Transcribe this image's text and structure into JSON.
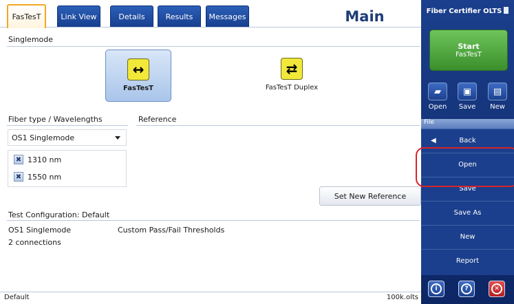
{
  "tabs": [
    {
      "label": "FasTesT",
      "active": true
    },
    {
      "label": "Link View",
      "active": false
    },
    {
      "label": "Details",
      "active": false
    },
    {
      "label": "Results",
      "active": false
    },
    {
      "label": "Messages",
      "active": false
    }
  ],
  "page_title": "Main",
  "mode_section": {
    "label": "Singlemode",
    "modes": [
      {
        "label": "FasTesT",
        "icon": "single-arrow-icon",
        "selected": true
      },
      {
        "label": "FasTesT Duplex",
        "icon": "duplex-arrows-icon",
        "selected": false
      }
    ]
  },
  "fiber": {
    "label": "Fiber type / Wavelengths",
    "selected": "OS1 Singlemode",
    "wavelengths": [
      "1310 nm",
      "1550 nm"
    ]
  },
  "reference": {
    "label": "Reference",
    "button_label": "Set New Reference"
  },
  "test_config": {
    "label": "Test Configuration: Default",
    "fiber_type": "OS1 Singlemode",
    "connections": "2 connections",
    "thresholds": "Custom Pass/Fail Thresholds"
  },
  "status": {
    "left": "Default",
    "right": "100k.olts"
  },
  "sidebar": {
    "title": "Fiber Certifier OLTS",
    "start": {
      "line1": "Start",
      "line2": "FasTesT"
    },
    "file_buttons": [
      {
        "label": "Open",
        "icon": "folder-icon"
      },
      {
        "label": "Save",
        "icon": "floppy-icon"
      },
      {
        "label": "New",
        "icon": "new-document-icon"
      }
    ],
    "menu_header": "File",
    "menu_items": [
      "Back",
      "Open",
      "Save",
      "Save As",
      "New",
      "Report"
    ],
    "bottom_icons": [
      "info-icon",
      "help-icon",
      "close-icon"
    ]
  },
  "colors": {
    "accent_orange": "#f5a623",
    "sidebar_blue": "#1b3f8c",
    "start_green": "#4caf3a",
    "highlight_red": "#d8232a"
  }
}
